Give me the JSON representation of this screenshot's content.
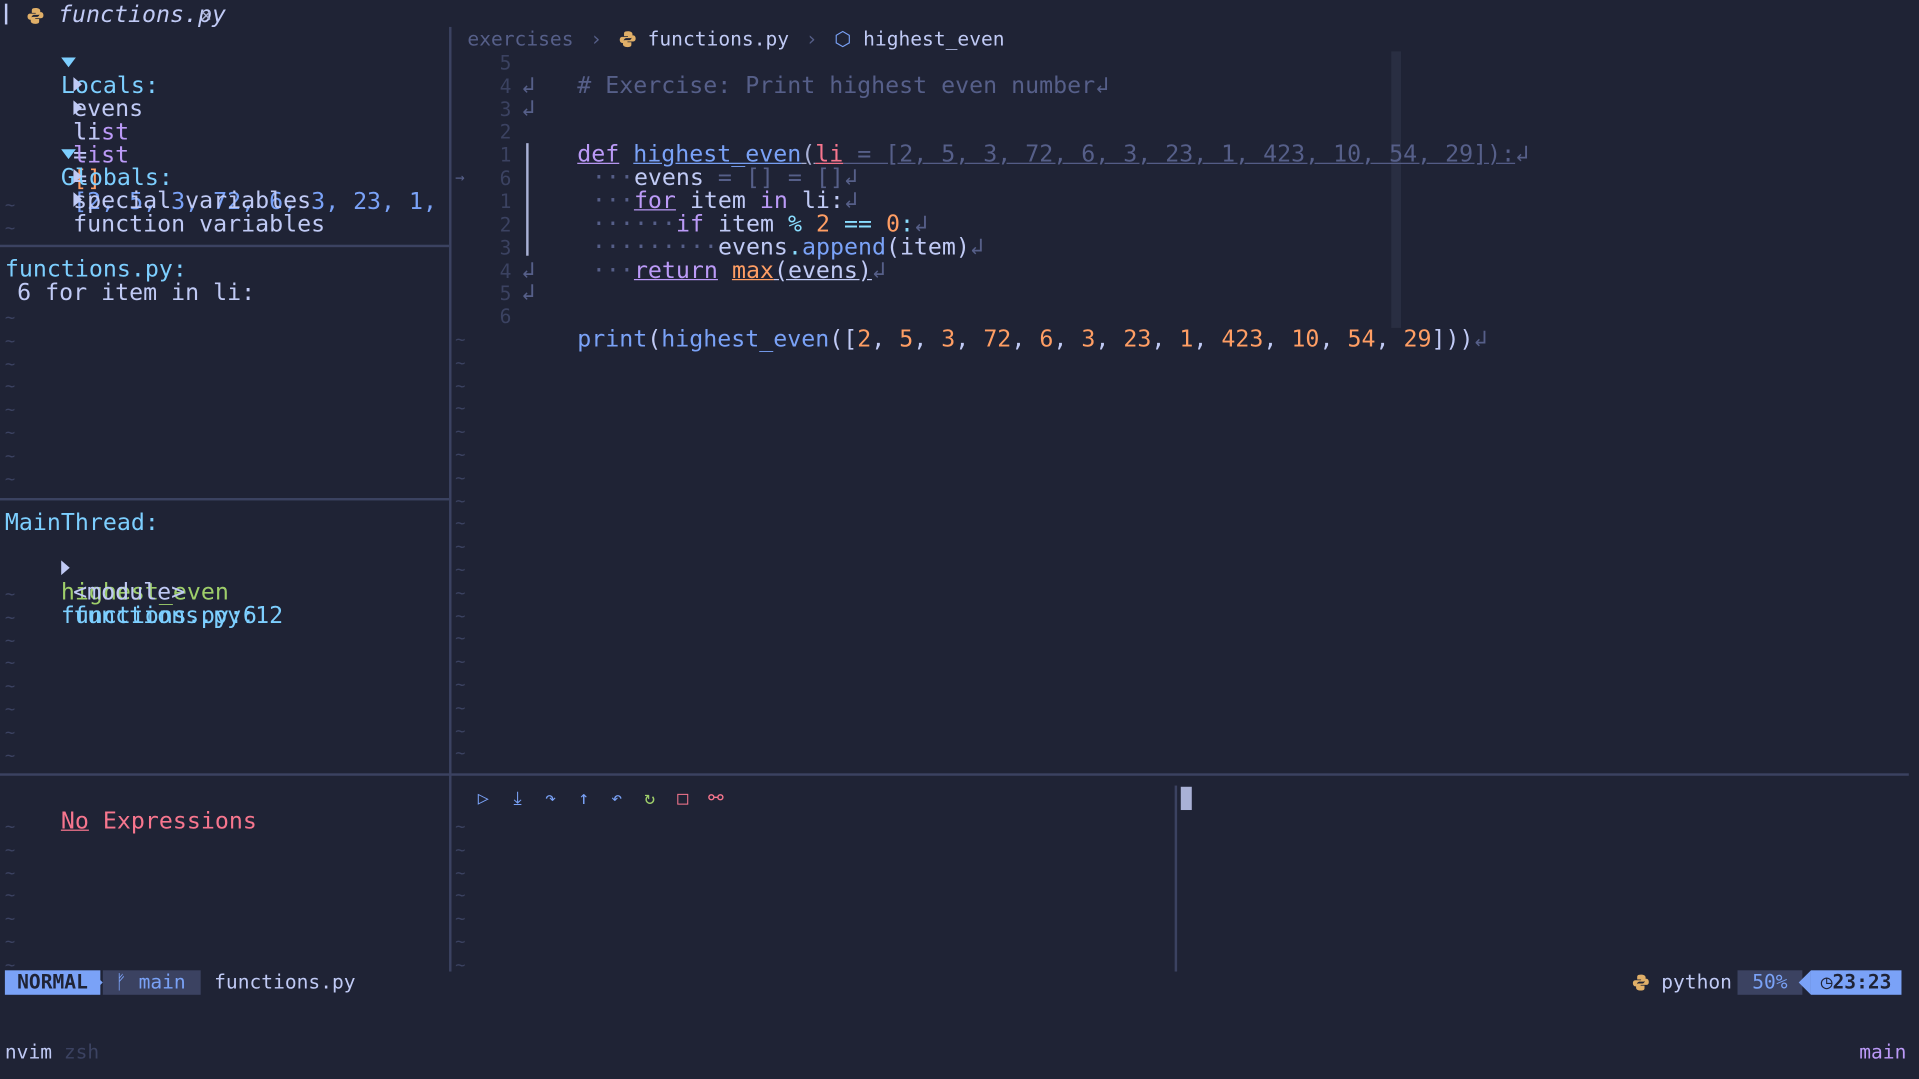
{
  "tab": {
    "filename": "functions.py",
    "close": "✕"
  },
  "breadcrumb": {
    "folder": "exercises",
    "file": "functions.py",
    "symbol": "highest_even",
    "sep": "›"
  },
  "locals": {
    "header": "Locals:",
    "items": [
      {
        "name": "evens",
        "type": "list",
        "eq": "=",
        "value": "[]"
      },
      {
        "name": "li",
        "type": "list",
        "eq": "=",
        "value": "[2, 5, 3, 72, 6, 3, 23, 1,"
      }
    ]
  },
  "globals": {
    "header": "Globals:",
    "items": [
      "special variables",
      "function variables"
    ]
  },
  "breakpoints": {
    "file": "functions.py:",
    "line": "6 for item in li:"
  },
  "stacks": {
    "thread": "MainThread:",
    "frames": [
      {
        "name": "highest_even",
        "loc": "functions.py:6"
      },
      {
        "name": "<module>",
        "loc": "functions.py:12"
      }
    ]
  },
  "watches": {
    "no": "No",
    "rest": " Expressions"
  },
  "code": {
    "line_numbers": [
      "5",
      "4",
      "3",
      "2",
      "1",
      "6",
      "1",
      "2",
      "3",
      "4",
      "5",
      "6"
    ],
    "current_marker": "→",
    "comment": "# Exercise: Print highest even number",
    "def_kw": "def",
    "def_name": "highest_even",
    "def_param": "li",
    "def_default": " = [2, 5, 3, 72, 6, 3, 23, 1, 423, 10, 54, 29]):",
    "evens_line": "evens",
    "evens_rest": " = [] = []",
    "for_kw": "for",
    "for_mid": " item ",
    "in_kw": "in",
    "for_rest": " li:",
    "if_kw": "if",
    "if_item": " item ",
    "if_op": "% ",
    "if_num2": "2",
    "if_eq": " == ",
    "if_num0": "0",
    "if_colon": ":",
    "append_obj": "evens",
    "append_dot": ".",
    "append_fn": "append",
    "append_args": "(item)",
    "return_kw": "return",
    "max_fn": "max",
    "max_args": "(evens)",
    "print_fn": "print",
    "print_open": "(",
    "print_call": "highest_even",
    "print_list_open": "([",
    "print_nums": [
      "2",
      "5",
      "3",
      "72",
      "6",
      "3",
      "23",
      "1",
      "423",
      "10",
      "54",
      "29"
    ],
    "print_close": "]))",
    "eol": "↲",
    "indent_dots": "···"
  },
  "dap_controls": [
    "continue",
    "step-into",
    "step-over",
    "step-out",
    "step-back",
    "restart",
    "stop",
    "disconnect"
  ],
  "status": {
    "mode": "NORMAL",
    "branch_icon": "ᚠ",
    "branch": "main",
    "file": "functions.py",
    "lang": "python",
    "percent": "50%",
    "time": "23:23"
  },
  "cmdline": {
    "left": "nvim",
    "shell": "zsh",
    "right": "main"
  },
  "colors": {
    "bg": "#1f2335",
    "accent": "#7aa2f7",
    "keyword": "#bb9af7",
    "number": "#ff9e64",
    "cyan": "#7dcfff"
  }
}
